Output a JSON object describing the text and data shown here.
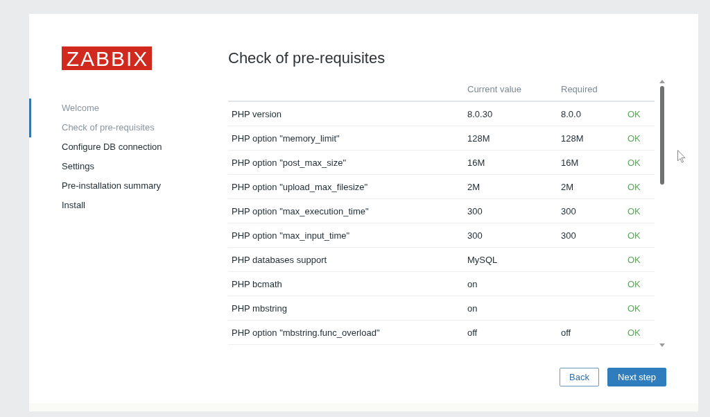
{
  "logo": "ZABBIX",
  "steps": [
    {
      "label": "Welcome",
      "completed": true
    },
    {
      "label": "Check of pre-requisites",
      "completed": true
    },
    {
      "label": "Configure DB connection",
      "completed": false
    },
    {
      "label": "Settings",
      "completed": false
    },
    {
      "label": "Pre-installation summary",
      "completed": false
    },
    {
      "label": "Install",
      "completed": false
    }
  ],
  "title": "Check of pre-requisites",
  "table": {
    "columns": [
      "Current value",
      "Required"
    ],
    "rows": [
      {
        "name": "PHP version",
        "current": "8.0.30",
        "required": "8.0.0",
        "status": "OK"
      },
      {
        "name": "PHP option \"memory_limit\"",
        "current": "128M",
        "required": "128M",
        "status": "OK"
      },
      {
        "name": "PHP option \"post_max_size\"",
        "current": "16M",
        "required": "16M",
        "status": "OK"
      },
      {
        "name": "PHP option \"upload_max_filesize\"",
        "current": "2M",
        "required": "2M",
        "status": "OK"
      },
      {
        "name": "PHP option \"max_execution_time\"",
        "current": "300",
        "required": "300",
        "status": "OK"
      },
      {
        "name": "PHP option \"max_input_time\"",
        "current": "300",
        "required": "300",
        "status": "OK"
      },
      {
        "name": "PHP databases support",
        "current": "MySQL",
        "status": "OK"
      },
      {
        "name": "PHP bcmath",
        "current": "on",
        "status": "OK"
      },
      {
        "name": "PHP mbstring",
        "current": "on",
        "status": "OK"
      },
      {
        "name": "PHP option \"mbstring.func_overload\"",
        "current": "off",
        "required": "off",
        "status": "OK"
      }
    ]
  },
  "buttons": [
    {
      "label": "Back",
      "kind": "secondary"
    },
    {
      "label": "Next step",
      "kind": "primary"
    }
  ]
}
